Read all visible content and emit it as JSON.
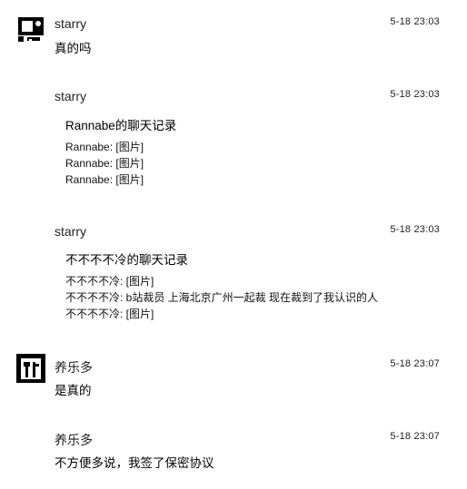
{
  "messages": [
    {
      "sender": "starry",
      "time": "5-18 23:03",
      "text": "真的吗"
    },
    {
      "sender": "starry",
      "time": "5-18 23:03",
      "record": {
        "title": "Rannabe的聊天记录",
        "lines": [
          "Rannabe: [图片]",
          "Rannabe: [图片]",
          "Rannabe: [图片]"
        ]
      }
    },
    {
      "sender": "starry",
      "time": "5-18 23:03",
      "record": {
        "title": "不不不不冷的聊天记录",
        "lines": [
          "不不不不冷: [图片]",
          "不不不不冷: b站裁员 上海北京广州一起裁  现在裁到了我认识的人",
          "不不不不冷: [图片]"
        ]
      }
    },
    {
      "sender": "养乐多",
      "time": "5-18 23:07",
      "text": "是真的"
    },
    {
      "sender": "养乐多",
      "time": "5-18 23:07",
      "text": "不方便多说，我签了保密协议"
    }
  ]
}
